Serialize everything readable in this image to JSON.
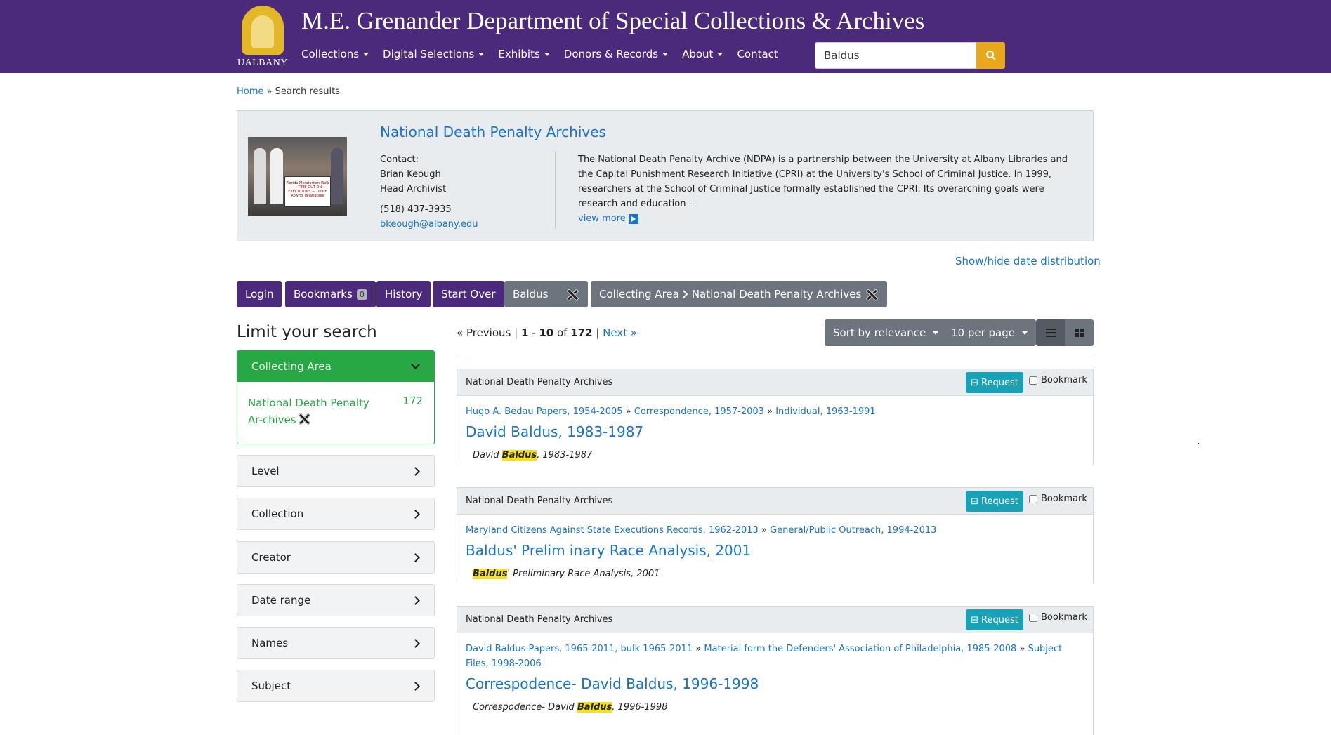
{
  "header": {
    "logo_text": "UALBANY",
    "title": "M.E. Grenander Department of Special Collections & Archives",
    "nav": [
      "Collections",
      "Digital Selections",
      "Exhibits",
      "Donors & Records",
      "About",
      "Contact"
    ],
    "search_value": "Baldus",
    "accent": "#4b2a7b",
    "search_button_color": "#e8a81d"
  },
  "breadcrumb": {
    "home": "Home",
    "separator": "»",
    "current": "Search results"
  },
  "repository": {
    "name": "National Death Penalty Archives",
    "contact_label": "Contact:",
    "contact_name": "Brian Keough",
    "contact_role": "Head Archivist",
    "phone": "(518) 437-3935",
    "email": "bkeough@albany.edu",
    "description": "The National Death Penalty Archive (NDPA) is a partnership between the University at Albany Libraries and the Capital Punishment Research Initiative (CPRI) at the University's School of Criminal Justice. In 1999, researchers at the School of Criminal Justice formally established the CPRI. Its overarching goals were research and education --",
    "view_more": "view more",
    "photo_sign": "Florida Moratorium Walk — TIME-OUT ON EXECUTIONS — Death Row to Tallahassee"
  },
  "show_hide": "Show/hide date distribution",
  "constraints": {
    "login": "Login",
    "bookmarks": "Bookmarks",
    "bookmarks_count": "0",
    "history": "History",
    "start_over": "Start Over",
    "query": "Baldus",
    "filter_field": "Collecting Area",
    "filter_value": "National Death Penalty Archives"
  },
  "sidebar": {
    "title": "Limit your search",
    "open_facet": {
      "label": "Collecting Area",
      "value": "National Death Penalty Ar-chives",
      "count": "172"
    },
    "facets": [
      "Level",
      "Collection",
      "Creator",
      "Date range",
      "Names",
      "Subject"
    ]
  },
  "pagination": {
    "previous": "« Previous",
    "start": "1",
    "end": "10",
    "of": "of",
    "total": "172",
    "next": "Next »"
  },
  "sort": {
    "label": "Sort by relevance",
    "per_page": "10 per page"
  },
  "results": [
    {
      "repo": "National Death Penalty Archives",
      "request": "⊟ Request",
      "bookmark": "Bookmark",
      "crumbs": [
        "Hugo A. Bedau Papers, 1954-2005",
        "Correspondence, 1957-2003",
        "Individual, 1963-1991"
      ],
      "title": "David Baldus, 1983-1987",
      "snippet_pre": "David ",
      "snippet_hl": "Baldus",
      "snippet_post": ", 1983-1987"
    },
    {
      "repo": "National Death Penalty Archives",
      "request": "⊟ Request",
      "bookmark": "Bookmark",
      "crumbs": [
        "Maryland Citizens Against State Executions Records, 1962-2013",
        "General/Public Outreach, 1994-2013"
      ],
      "title": "Baldus' Prelim inary Race Analysis, 2001",
      "snippet_pre": "",
      "snippet_hl": "Baldus",
      "snippet_post": "' Preliminary Race Analysis, 2001"
    },
    {
      "repo": "National Death Penalty Archives",
      "request": "⊟ Request",
      "bookmark": "Bookmark",
      "crumbs": [
        "David Baldus Papers, 1965-2011, bulk 1965-2011",
        "Material form the Defenders' Association of Philadelphia, 1985-2008",
        "Subject Files, 1998-2006"
      ],
      "title": "Correspodence- David Baldus, 1996-1998",
      "snippet_pre": "Correspodence- David ",
      "snippet_hl": "Baldus",
      "snippet_post": ", 1996-1998"
    }
  ],
  "crumb_separator": "»"
}
